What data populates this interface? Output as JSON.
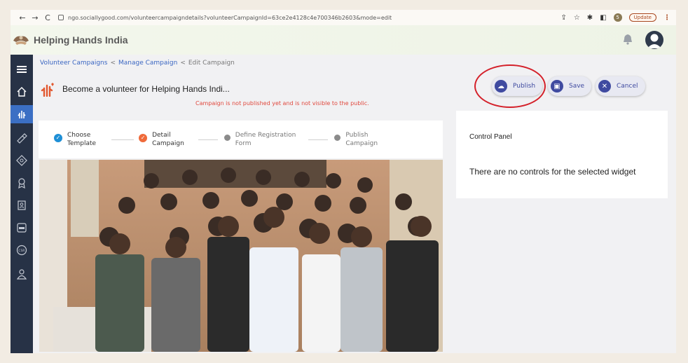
{
  "browser": {
    "back": "←",
    "forward": "→",
    "reload": "C",
    "url": "ngo.sociallygood.com/volunteercampaigndetails?volunteerCampaignId=63ce2e4128c4e700346b2603&mode=edit",
    "share": "⇪",
    "star": "☆",
    "extensions": "✱",
    "side_panel": "◧",
    "profile_initial": "5",
    "update_label": "Update",
    "menu": "⋮"
  },
  "app": {
    "brand": "Helping Hands India"
  },
  "breadcrumb": {
    "item1": "Volunteer Campaigns",
    "sep1": "<",
    "item2": "Manage Campaign",
    "sep2": "<",
    "current": "Edit Campaign"
  },
  "campaign": {
    "title": "Become a volunteer for Helping Hands Indi...",
    "warning": "Campaign is not published yet and is not visible to the public."
  },
  "actions": {
    "publish": "Publish",
    "save": "Save",
    "cancel": "Cancel"
  },
  "steps": [
    {
      "line1": "Choose",
      "line2": "Template",
      "status": "done"
    },
    {
      "line1": "Detail",
      "line2": "Campaign",
      "status": "current"
    },
    {
      "line1": "Define Registration",
      "line2": "Form",
      "status": "pending"
    },
    {
      "line1": "Publish",
      "line2": "Campaign",
      "status": "pending"
    }
  ],
  "control_panel": {
    "title": "Control Panel",
    "message": "There are no controls for the selected widget"
  },
  "sidebar_icons": [
    "menu-icon",
    "home-icon",
    "volunteer-hand-icon",
    "campaign-icon",
    "badge-icon",
    "award-icon",
    "contacts-icon",
    "ngo-icon",
    "csr-icon",
    "users-icon"
  ],
  "colors": {
    "sidebar": "#273246",
    "active": "#3b6fc4",
    "accent": "#3f4aa0",
    "warning": "#e0483d",
    "step_done": "#1e8fd6",
    "step_current": "#ef6a3a",
    "highlight": "#d4212a"
  }
}
